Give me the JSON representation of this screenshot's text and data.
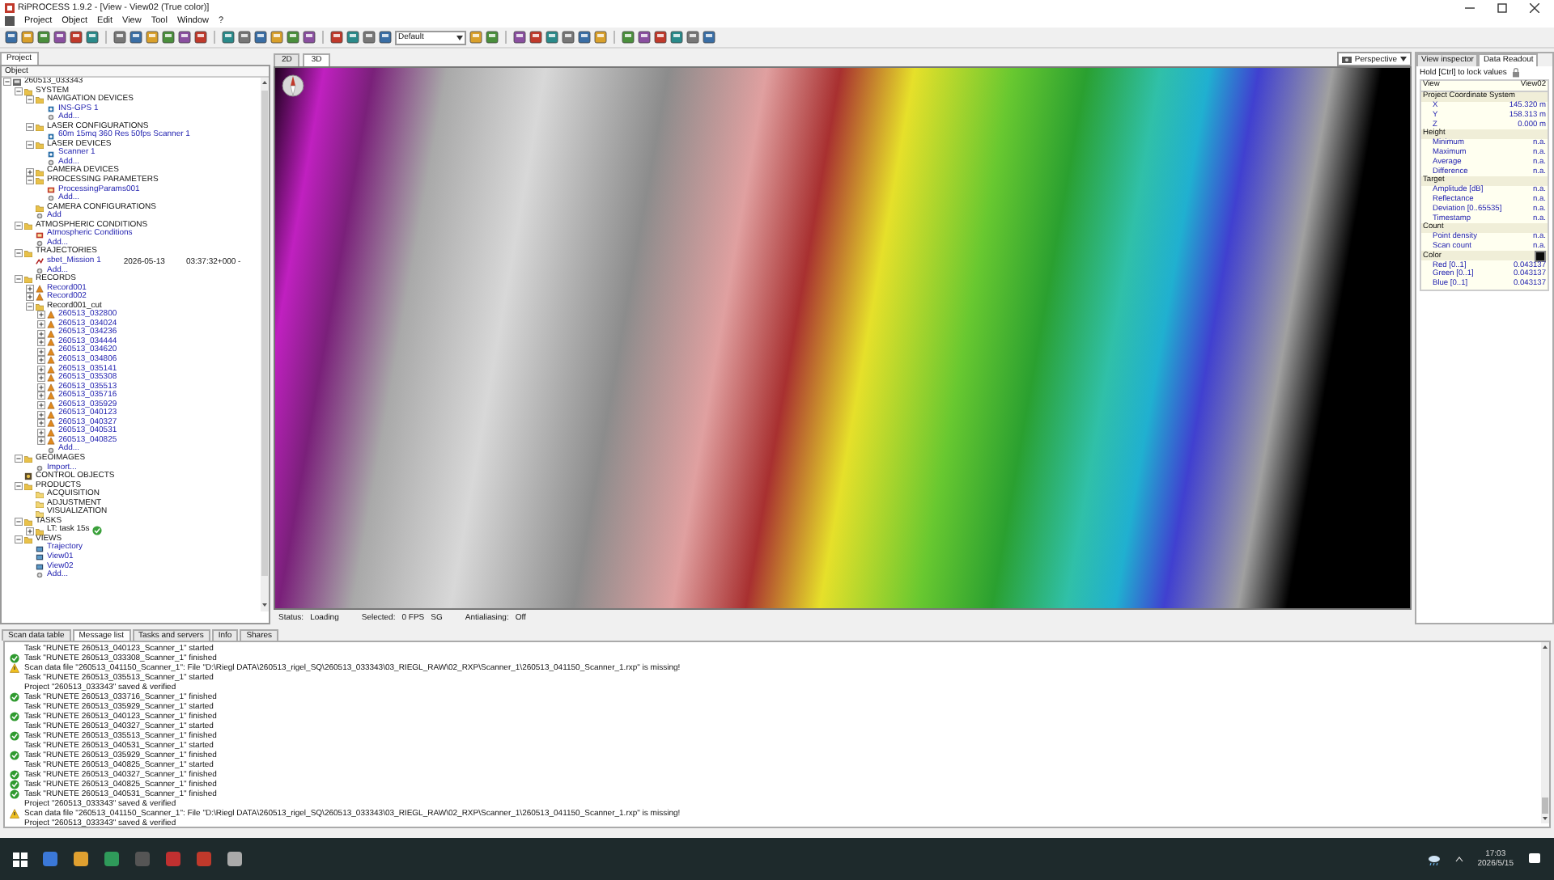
{
  "window": {
    "title": "RiPROCESS 1.9.2 - [View - View02 (True color)]"
  },
  "menu": [
    "Project",
    "Object",
    "Edit",
    "View",
    "Tool",
    "Window",
    "?"
  ],
  "toolbar": {
    "preset": "Default"
  },
  "project_panel": {
    "tab": "Project",
    "header": "Object",
    "tree": [
      {
        "label": "260513_033343",
        "kind": "project",
        "expanded": true,
        "children": [
          {
            "label": "SYSTEM",
            "kind": "folder",
            "expanded": true,
            "children": [
              {
                "label": "NAVIGATION DEVICES",
                "kind": "folder",
                "expanded": true,
                "children": [
                  {
                    "label": "INS-GPS 1",
                    "kind": "device"
                  },
                  {
                    "label": "Add...",
                    "kind": "add"
                  }
                ]
              },
              {
                "label": "LASER CONFIGURATIONS",
                "kind": "folder",
                "expanded": true,
                "children": [
                  {
                    "label": "60m 15mq 360 Res 50fps Scanner 1",
                    "kind": "device"
                  }
                ]
              },
              {
                "label": "LASER DEVICES",
                "kind": "folder",
                "expanded": true,
                "children": [
                  {
                    "label": "Scanner 1",
                    "kind": "device"
                  },
                  {
                    "label": "Add...",
                    "kind": "add"
                  }
                ]
              },
              {
                "label": "CAMERA DEVICES",
                "kind": "folder",
                "expanded": false
              },
              {
                "label": "PROCESSING PARAMETERS",
                "kind": "folder",
                "expanded": true,
                "children": [
                  {
                    "label": "ProcessingParams001",
                    "kind": "item"
                  },
                  {
                    "label": "Add...",
                    "kind": "add"
                  }
                ]
              },
              {
                "label": "CAMERA CONFIGURATIONS",
                "kind": "folder"
              },
              {
                "label": "Add",
                "kind": "add"
              }
            ]
          },
          {
            "label": "ATMOSPHERIC CONDITIONS",
            "kind": "folder",
            "expanded": true,
            "children": [
              {
                "label": "Atmospheric Conditions",
                "kind": "item"
              },
              {
                "label": "Add...",
                "kind": "add"
              }
            ]
          },
          {
            "label": "TRAJECTORIES",
            "kind": "folder",
            "expanded": true,
            "children": [
              {
                "label": "sbet_Mission 1",
                "kind": "trajectory",
                "date": "2026-05-13",
                "time": "03:37:32+000 -"
              },
              {
                "label": "Add...",
                "kind": "add"
              }
            ]
          },
          {
            "label": "RECORDS",
            "kind": "folder",
            "expanded": true,
            "children": [
              {
                "label": "Record001",
                "kind": "record",
                "expanded": false
              },
              {
                "label": "Record002",
                "kind": "record",
                "expanded": false
              },
              {
                "label": "Record001_cut",
                "kind": "folder",
                "expanded": true,
                "children": [
                  {
                    "label": "260513_032800",
                    "kind": "scan",
                    "expanded": false
                  },
                  {
                    "label": "260513_034024",
                    "kind": "scan",
                    "expanded": false
                  },
                  {
                    "label": "260513_034236",
                    "kind": "scan",
                    "expanded": false
                  },
                  {
                    "label": "260513_034444",
                    "kind": "scan",
                    "expanded": false
                  },
                  {
                    "label": "260513_034620",
                    "kind": "scan",
                    "expanded": false
                  },
                  {
                    "label": "260513_034806",
                    "kind": "scan",
                    "expanded": false
                  },
                  {
                    "label": "260513_035141",
                    "kind": "scan",
                    "expanded": false
                  },
                  {
                    "label": "260513_035308",
                    "kind": "scan",
                    "expanded": false
                  },
                  {
                    "label": "260513_035513",
                    "kind": "scan",
                    "expanded": false
                  },
                  {
                    "label": "260513_035716",
                    "kind": "scan",
                    "expanded": false
                  },
                  {
                    "label": "260513_035929",
                    "kind": "scan",
                    "expanded": false
                  },
                  {
                    "label": "260513_040123",
                    "kind": "scan",
                    "expanded": false
                  },
                  {
                    "label": "260513_040327",
                    "kind": "scan",
                    "expanded": false
                  },
                  {
                    "label": "260513_040531",
                    "kind": "scan",
                    "expanded": false
                  },
                  {
                    "label": "260513_040825",
                    "kind": "scan",
                    "expanded": false
                  },
                  {
                    "label": "Add...",
                    "kind": "add"
                  }
                ]
              }
            ]
          },
          {
            "label": "GEOIMAGES",
            "kind": "folder",
            "expanded": true,
            "children": [
              {
                "label": "Import...",
                "kind": "add"
              }
            ]
          },
          {
            "label": "CONTROL OBJECTS",
            "kind": "control"
          },
          {
            "label": "PRODUCTS",
            "kind": "folder",
            "expanded": true,
            "children": [
              {
                "label": "ACQUISITION",
                "kind": "subfolder"
              },
              {
                "label": "ADJUSTMENT",
                "kind": "subfolder"
              },
              {
                "label": "VISUALIZATION",
                "kind": "subfolder"
              }
            ]
          },
          {
            "label": "TASKS",
            "kind": "folder",
            "expanded": true,
            "children": [
              {
                "label": "LT: task 15s",
                "kind": "task",
                "expanded": false
              }
            ]
          },
          {
            "label": "VIEWS",
            "kind": "folder",
            "expanded": true,
            "children": [
              {
                "label": "Trajectory",
                "kind": "view"
              },
              {
                "label": "View01",
                "kind": "view"
              },
              {
                "label": "View02",
                "kind": "view"
              },
              {
                "label": "Add...",
                "kind": "add"
              }
            ]
          }
        ]
      }
    ]
  },
  "view": {
    "tabs": [
      {
        "label": "2D",
        "selected": false
      },
      {
        "label": "3D",
        "selected": true
      }
    ],
    "camera": "Perspective",
    "status": [
      {
        "label": "Status:",
        "value": "Loading"
      },
      {
        "label": "Selected:"
      },
      {
        "label": "0 FPS",
        "value": "SG"
      },
      {
        "label": "Antialiasing:",
        "value": "Off"
      }
    ]
  },
  "inspector": {
    "tabs": [
      {
        "label": "View inspector",
        "selected": false
      },
      {
        "label": "Data Readout",
        "selected": true
      }
    ],
    "hint": "Hold [Ctrl] to lock values",
    "columns": [
      "View",
      "View02"
    ],
    "sections": [
      {
        "title": "Project Coordinate System",
        "rows": [
          {
            "label": "X",
            "value": "145.320 m"
          },
          {
            "label": "Y",
            "value": "158.313 m"
          },
          {
            "label": "Z",
            "value": "0.000 m"
          }
        ]
      },
      {
        "title": "Height",
        "rows": [
          {
            "label": "Minimum",
            "value": "n.a."
          },
          {
            "label": "Maximum",
            "value": "n.a."
          },
          {
            "label": "Average",
            "value": "n.a."
          },
          {
            "label": "Difference",
            "value": "n.a."
          }
        ]
      },
      {
        "title": "Target",
        "rows": [
          {
            "label": "Amplitude [dB]",
            "value": "n.a."
          },
          {
            "label": "Reflectance",
            "value": "n.a."
          },
          {
            "label": "Deviation [0..65535]",
            "value": "n.a."
          },
          {
            "label": "Timestamp",
            "value": "n.a."
          }
        ]
      },
      {
        "title": "Count",
        "rows": [
          {
            "label": "Point density",
            "value": "n.a."
          },
          {
            "label": "Scan count",
            "value": "n.a."
          }
        ]
      },
      {
        "title": "Color",
        "color": "#0b0b0b",
        "rows": [
          {
            "label": "Red [0..1]",
            "value": "0.043137"
          },
          {
            "label": "Green [0..1]",
            "value": "0.043137"
          },
          {
            "label": "Blue [0..1]",
            "value": "0.043137"
          }
        ]
      }
    ]
  },
  "bottom_tabs": [
    {
      "label": "Scan data table",
      "selected": false
    },
    {
      "label": "Message list",
      "selected": true
    },
    {
      "label": "Tasks and servers",
      "selected": false
    },
    {
      "label": "Info",
      "selected": false
    },
    {
      "label": "Shares",
      "selected": false
    }
  ],
  "messages": [
    {
      "kind": "info",
      "text": "Task \"RUNETE 260513_040123_Scanner_1\" started"
    },
    {
      "kind": "ok",
      "text": "Task \"RUNETE 260513_033308_Scanner_1\" finished"
    },
    {
      "kind": "warning",
      "text": "Scan data file \"260513_041150_Scanner_1\": File \"D:\\Riegl DATA\\260513_rigel_SQ\\260513_033343\\03_RIEGL_RAW\\02_RXP\\Scanner_1\\260513_041150_Scanner_1.rxp\" is missing!"
    },
    {
      "kind": "info",
      "text": "Task \"RUNETE 260513_035513_Scanner_1\" started"
    },
    {
      "kind": "info",
      "text": "Project \"260513_033343\" saved & verified"
    },
    {
      "kind": "ok",
      "text": "Task \"RUNETE 260513_033716_Scanner_1\" finished"
    },
    {
      "kind": "info",
      "text": "Task \"RUNETE 260513_035929_Scanner_1\" started"
    },
    {
      "kind": "ok",
      "text": "Task \"RUNETE 260513_040123_Scanner_1\" finished"
    },
    {
      "kind": "info",
      "text": "Task \"RUNETE 260513_040327_Scanner_1\" started"
    },
    {
      "kind": "ok",
      "text": "Task \"RUNETE 260513_035513_Scanner_1\" finished"
    },
    {
      "kind": "info",
      "text": "Task \"RUNETE 260513_040531_Scanner_1\" started"
    },
    {
      "kind": "ok",
      "text": "Task \"RUNETE 260513_035929_Scanner_1\" finished"
    },
    {
      "kind": "info",
      "text": "Task \"RUNETE 260513_040825_Scanner_1\" started"
    },
    {
      "kind": "ok",
      "text": "Task \"RUNETE 260513_040327_Scanner_1\" finished"
    },
    {
      "kind": "ok",
      "text": "Task \"RUNETE 260513_040825_Scanner_1\" finished"
    },
    {
      "kind": "ok",
      "text": "Task \"RUNETE 260513_040531_Scanner_1\" finished"
    },
    {
      "kind": "info",
      "text": "Project \"260513_033343\" saved & verified"
    },
    {
      "kind": "warning",
      "text": "Scan data file \"260513_041150_Scanner_1\": File \"D:\\Riegl DATA\\260513_rigel_SQ\\260513_033343\\03_RIEGL_RAW\\02_RXP\\Scanner_1\\260513_041150_Scanner_1.rxp\" is missing!"
    },
    {
      "kind": "info",
      "text": "Project \"260513_033343\" saved & verified"
    }
  ],
  "taskbar": {
    "time": "17:03",
    "date": "2026/5/15"
  }
}
